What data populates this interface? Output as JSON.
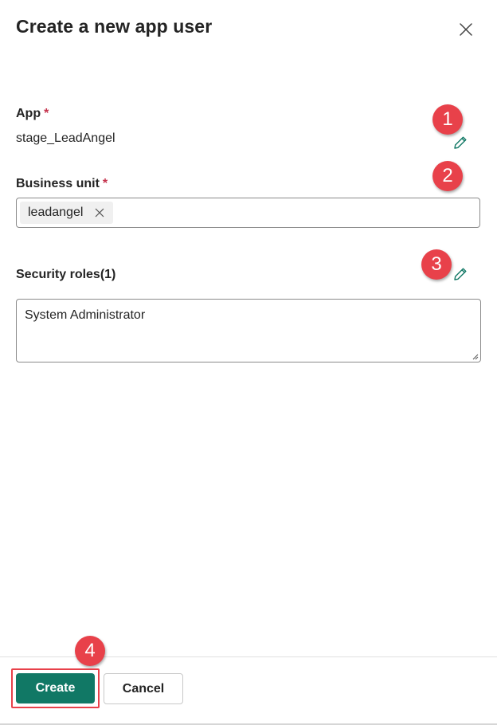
{
  "dialog": {
    "title": "Create a new app user",
    "close_icon": "close-icon"
  },
  "app_field": {
    "label": "App",
    "required_mark": "*",
    "value": "stage_LeadAngel",
    "edit_icon": "pencil-icon"
  },
  "business_unit_field": {
    "label": "Business unit",
    "required_mark": "*",
    "tag_label": "leadangel",
    "tag_remove_icon": "close-icon"
  },
  "security_roles_field": {
    "label": "Security roles(1)",
    "value": "System Administrator",
    "edit_icon": "pencil-icon"
  },
  "callouts": [
    "1",
    "2",
    "3",
    "4"
  ],
  "footer": {
    "create_label": "Create",
    "cancel_label": "Cancel"
  },
  "colors": {
    "primary": "#117865",
    "edit_icon": "#117865",
    "required": "#c4314b",
    "callout": "#e8414a"
  }
}
